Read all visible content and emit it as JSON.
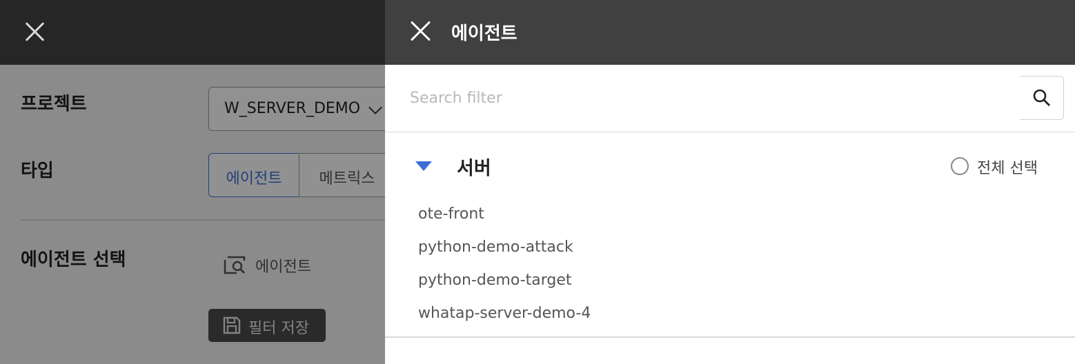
{
  "background_form": {
    "labels": {
      "project": "프로젝트",
      "type": "타입",
      "agent_select": "에이전트 선택"
    },
    "project_select": {
      "value": "W_SERVER_DEMO"
    },
    "type_segments": [
      {
        "label": "에이전트",
        "selected": true
      },
      {
        "label": "메트릭스",
        "selected": false
      }
    ],
    "agent_link": {
      "label": "에이전트",
      "icon": "agent-search-icon"
    },
    "save_filter_button": {
      "label": "필터 저장",
      "icon": "save-icon"
    }
  },
  "drawer": {
    "title": "에이전트",
    "close_icon": "close-icon",
    "search": {
      "placeholder": "Search filter",
      "value": "",
      "icon": "search-icon"
    },
    "groups": [
      {
        "title": "서버",
        "expanded": true,
        "select_all_label": "전체 선택",
        "select_all_checked": false,
        "items": [
          "ote-front",
          "python-demo-attack",
          "python-demo-target",
          "whatap-server-demo-4"
        ]
      }
    ]
  },
  "colors": {
    "accent": "#3b6fd6",
    "drawer_header": "#404040",
    "background_header": "#262626",
    "dim_overlay": "rgba(0,0,0,0.43)"
  }
}
